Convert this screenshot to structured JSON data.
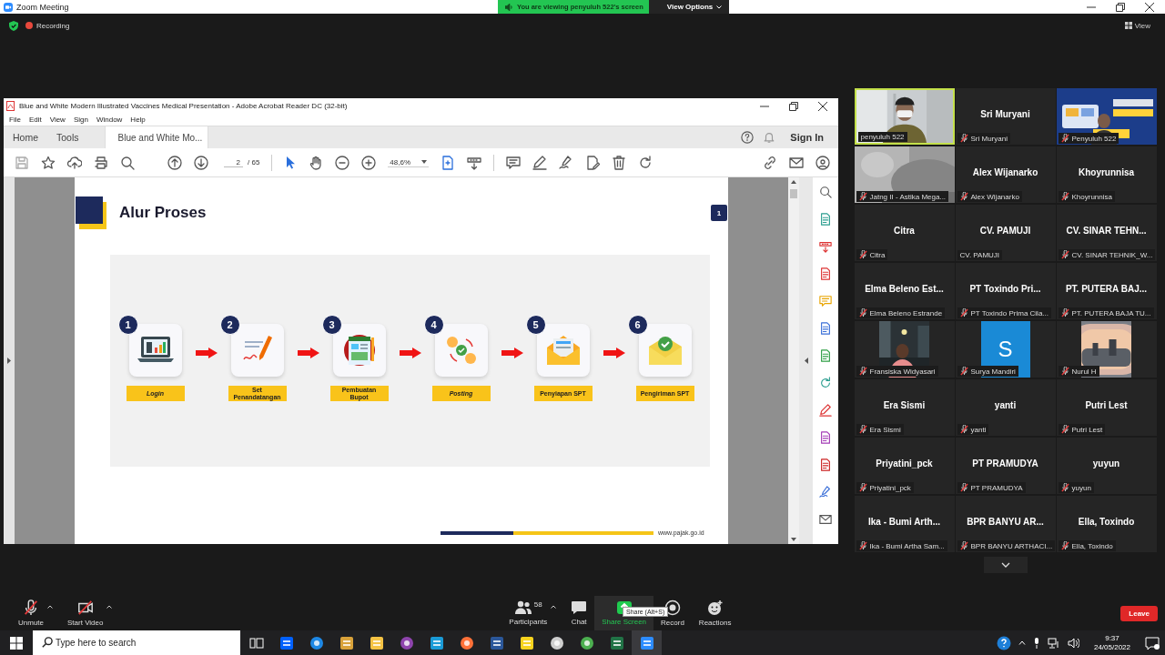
{
  "zoom_window": {
    "title": "Zoom Meeting"
  },
  "share_banner": {
    "text": "You are viewing penyuluh 522's screen",
    "view_options": "View Options"
  },
  "recording": {
    "label": "Recording"
  },
  "view_button": {
    "label": "View"
  },
  "shared_screen": {
    "title": "Blue and White Modern Illustrated Vaccines Medical Presentation - Adobe Acrobat Reader DC (32-bit)",
    "menu": [
      "File",
      "Edit",
      "View",
      "Sign",
      "Window",
      "Help"
    ],
    "tabs": [
      {
        "label": "Home",
        "selected": false
      },
      {
        "label": "Tools",
        "selected": false
      },
      {
        "label": "Blue and White Mo...",
        "selected": true
      }
    ],
    "sign_in": "Sign In",
    "page_field": "2",
    "page_total": "/ 65",
    "zoom_field": "48,6%",
    "slide": {
      "title": "Alur Proses",
      "page_badge": "1",
      "footer": "www.pajak.go.id",
      "steps": [
        {
          "number": "1",
          "label": "Login",
          "italic": true
        },
        {
          "number": "2",
          "label": "Set Penandatangan",
          "italic": false
        },
        {
          "number": "3",
          "label": "Pembuatan Bupot",
          "italic": false
        },
        {
          "number": "4",
          "label": "Posting",
          "italic": true
        },
        {
          "number": "5",
          "label": "Penyiapan SPT",
          "italic": false
        },
        {
          "number": "6",
          "label": "Pengiriman SPT",
          "italic": false
        }
      ]
    }
  },
  "participants": [
    {
      "kind": "video",
      "label": "penyuluh 522",
      "muted": false,
      "active_speaker": true
    },
    {
      "kind": "name",
      "name": "Sri Muryani",
      "label": "Sri Muryani",
      "muted": true,
      "active_speaker": false
    },
    {
      "kind": "video",
      "label": "Penyuluh 522",
      "muted": true,
      "active_speaker": false
    },
    {
      "kind": "video",
      "label": "Jatng II - Astika Mega...",
      "muted": true,
      "active_speaker": false
    },
    {
      "kind": "name",
      "name": "Alex Wijanarko",
      "label": "Alex Wijanarko",
      "muted": true,
      "active_speaker": false
    },
    {
      "kind": "name",
      "name": "Khoyrunnisa",
      "label": "Khoyrunnisa",
      "muted": true,
      "active_speaker": false
    },
    {
      "kind": "name",
      "name": "Citra",
      "label": "Citra",
      "muted": true,
      "active_speaker": false
    },
    {
      "kind": "name",
      "name": "CV. PAMUJI",
      "label": "CV. PAMUJI",
      "muted": false,
      "active_speaker": false
    },
    {
      "kind": "name",
      "name": "CV. SINAR TEHN...",
      "label": "CV. SINAR TEHNIK_W...",
      "muted": true,
      "active_speaker": false
    },
    {
      "kind": "name",
      "name": "Elma Beleno Est...",
      "label": "Elma Beleno Estrande",
      "muted": true,
      "active_speaker": false
    },
    {
      "kind": "name",
      "name": "PT Toxindo Pri...",
      "label": "PT Toxindo Prima Cila...",
      "muted": true,
      "active_speaker": false
    },
    {
      "kind": "name",
      "name": "PT. PUTERA BAJ...",
      "label": "PT. PUTERA BAJA TU...",
      "muted": true,
      "active_speaker": false
    },
    {
      "label": "Fransiska Widyasari",
      "muted": true,
      "active_speaker": false
    },
    {
      "kind": "initial",
      "initial": "S",
      "label": "Surya Mandiri",
      "muted": true,
      "active_speaker": false
    },
    {
      "label": "Nurul H",
      "muted": true,
      "active_speaker": false
    },
    {
      "kind": "name",
      "name": "Era Sismi",
      "label": "Era Sismi",
      "muted": true,
      "active_speaker": false
    },
    {
      "kind": "name",
      "name": "yanti",
      "label": "yanti",
      "muted": true,
      "active_speaker": false
    },
    {
      "kind": "name",
      "name": "Putri Lest",
      "label": "Putri Lest",
      "muted": true,
      "active_speaker": false
    },
    {
      "kind": "name",
      "name": "Priyatini_pck",
      "label": "Priyatini_pck",
      "muted": true,
      "active_speaker": false
    },
    {
      "kind": "name",
      "name": "PT PRAMUDYA",
      "label": "PT PRAMUDYA",
      "muted": true,
      "active_speaker": false
    },
    {
      "kind": "name",
      "name": "yuyun",
      "label": "yuyun",
      "muted": true,
      "active_speaker": false
    },
    {
      "kind": "name",
      "name": "Ika - Bumi Arth...",
      "label": "Ika - Bumi Artha Sam...",
      "muted": true,
      "active_speaker": false
    },
    {
      "kind": "name",
      "name": "BPR BANYU AR...",
      "label": "BPR BANYU ARTHACI...",
      "muted": true,
      "active_speaker": false
    },
    {
      "kind": "name",
      "name": "Ella, Toxindo",
      "label": "Ella, Toxindo",
      "muted": true,
      "active_speaker": false
    }
  ],
  "toolbar": {
    "buttons": [
      {
        "kind": "mic",
        "label": "Unmute",
        "hovered": false
      },
      {
        "kind": "video",
        "label": "Start Video",
        "hovered": false
      },
      {
        "kind": "participants",
        "label": "Participants",
        "count": "58",
        "hovered": false
      },
      {
        "kind": "chat",
        "label": "Chat",
        "hovered": false
      },
      {
        "kind": "share",
        "label": "Share Screen",
        "hovered": true
      },
      {
        "kind": "record",
        "label": "Record",
        "hovered": false
      },
      {
        "kind": "reactions",
        "label": "Reactions",
        "hovered": false
      }
    ],
    "tooltip": "Share (Alt+S)",
    "leave": "Leave"
  },
  "taskbar": {
    "search_placeholder": "Type here to search",
    "time": "9:37",
    "date": "24/05/2022"
  }
}
